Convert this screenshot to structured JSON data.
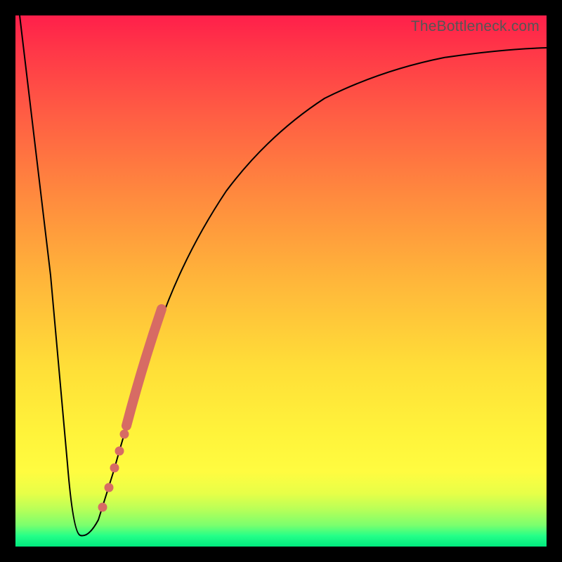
{
  "watermark": "TheBottleneck.com",
  "colors": {
    "accent_dots": "#d76b64",
    "curve": "#000000",
    "frame": "#000000"
  },
  "chart_data": {
    "type": "line",
    "title": "",
    "xlabel": "",
    "ylabel": "",
    "xlim": [
      0,
      100
    ],
    "ylim": [
      0,
      100
    ],
    "grid": false,
    "series": [
      {
        "name": "bottleneck-curve",
        "x": [
          0,
          4,
          8,
          10,
          11,
          12,
          14,
          16,
          18,
          20,
          22,
          24,
          27,
          30,
          34,
          40,
          48,
          58,
          70,
          85,
          100
        ],
        "y": [
          100,
          60,
          18,
          4,
          2,
          2,
          4,
          9,
          16,
          24,
          33,
          41,
          51,
          60,
          68,
          76,
          83,
          88,
          91,
          92.5,
          93
        ]
      }
    ],
    "highlight_segment": {
      "name": "bold-range",
      "x": [
        20,
        27
      ],
      "y": [
        24,
        51
      ]
    },
    "markers": [
      {
        "x": 15.2,
        "y": 6.5
      },
      {
        "x": 16.5,
        "y": 10.5
      },
      {
        "x": 17.6,
        "y": 14.5
      },
      {
        "x": 18.4,
        "y": 17.5
      },
      {
        "x": 19.2,
        "y": 21.0
      }
    ]
  }
}
